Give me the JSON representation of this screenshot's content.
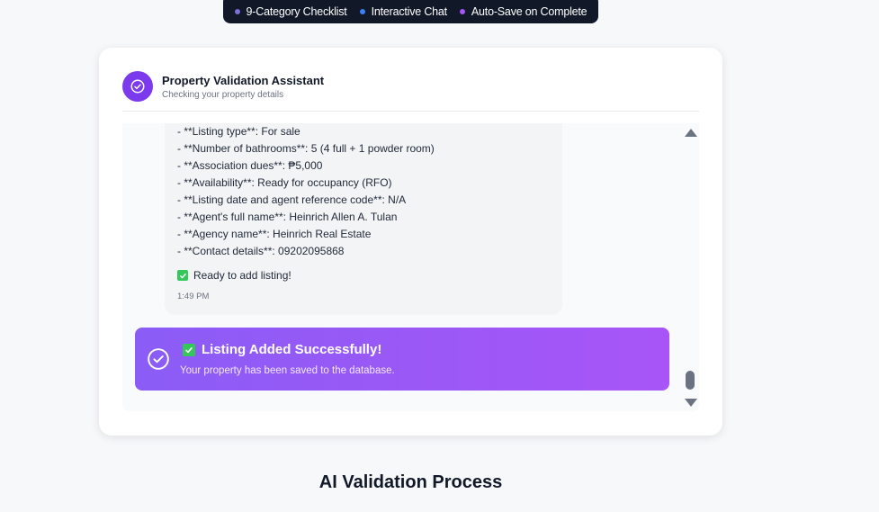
{
  "top_bar": {
    "items": [
      {
        "label": "9-Category Checklist",
        "dot_color": "#7c6fd6"
      },
      {
        "label": "Interactive Chat",
        "dot_color": "#3b82f6"
      },
      {
        "label": "Auto-Save on Complete",
        "dot_color": "#a855f7"
      }
    ]
  },
  "assistant": {
    "title": "Property Validation Assistant",
    "subtitle": "Checking your property details",
    "icon": "check-circle-icon"
  },
  "message": {
    "lines": [
      "- **Listing type**: For sale",
      "- **Number of bathrooms**: 5 (4 full + 1 powder room)",
      "- **Association dues**: ₱5,000",
      "- **Availability**: Ready for occupancy (RFO)",
      "- **Listing date and agent reference code**: N/A",
      "- **Agent's full name**: Heinrich Allen A. Tulan",
      "- **Agency name**: Heinrich Real Estate",
      "- **Contact details**: 09202095868"
    ],
    "ready_text": "Ready to add listing!",
    "time": "1:49 PM"
  },
  "success": {
    "title": "Listing Added Successfully!",
    "subtitle": "Your property has been saved to the database."
  },
  "section": {
    "title": "AI Validation Process"
  },
  "colors": {
    "accent": "#7c3aed",
    "success_gradient_start": "#8b5cf6",
    "success_gradient_end": "#a855f7"
  }
}
